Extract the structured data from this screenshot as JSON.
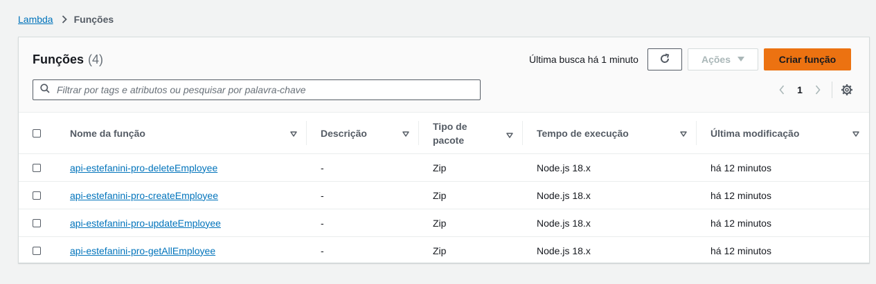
{
  "breadcrumb": {
    "root": "Lambda",
    "current": "Funções"
  },
  "header": {
    "title": "Funções",
    "count": "(4)",
    "last_fetch": "Última busca há 1 minuto",
    "actions_label": "Ações",
    "create_label": "Criar função"
  },
  "search": {
    "placeholder": "Filtrar por tags e atributos ou pesquisar por palavra-chave"
  },
  "pagination": {
    "current_page": "1"
  },
  "table": {
    "columns": {
      "name": "Nome da função",
      "description": "Descrição",
      "package_line1": "Tipo de",
      "package_line2": "pacote",
      "runtime": "Tempo de execução",
      "modified": "Última modificação"
    },
    "rows": [
      {
        "name": "api-estefanini-pro-deleteEmployee",
        "description": "-",
        "package": "Zip",
        "runtime": "Node.js 18.x",
        "modified": "há 12 minutos"
      },
      {
        "name": "api-estefanini-pro-createEmployee",
        "description": "-",
        "package": "Zip",
        "runtime": "Node.js 18.x",
        "modified": "há 12 minutos"
      },
      {
        "name": "api-estefanini-pro-updateEmployee",
        "description": "-",
        "package": "Zip",
        "runtime": "Node.js 18.x",
        "modified": "há 12 minutos"
      },
      {
        "name": "api-estefanini-pro-getAllEmployee",
        "description": "-",
        "package": "Zip",
        "runtime": "Node.js 18.x",
        "modified": "há 12 minutos"
      }
    ]
  },
  "colors": {
    "link": "#0073bb",
    "primary_button": "#ec7211",
    "background": "#f2f3f3"
  },
  "icons": [
    "chevron-right-icon",
    "refresh-icon",
    "caret-down-icon",
    "search-icon",
    "chevron-left-icon",
    "settings-gear-icon",
    "sort-caret-icon"
  ]
}
